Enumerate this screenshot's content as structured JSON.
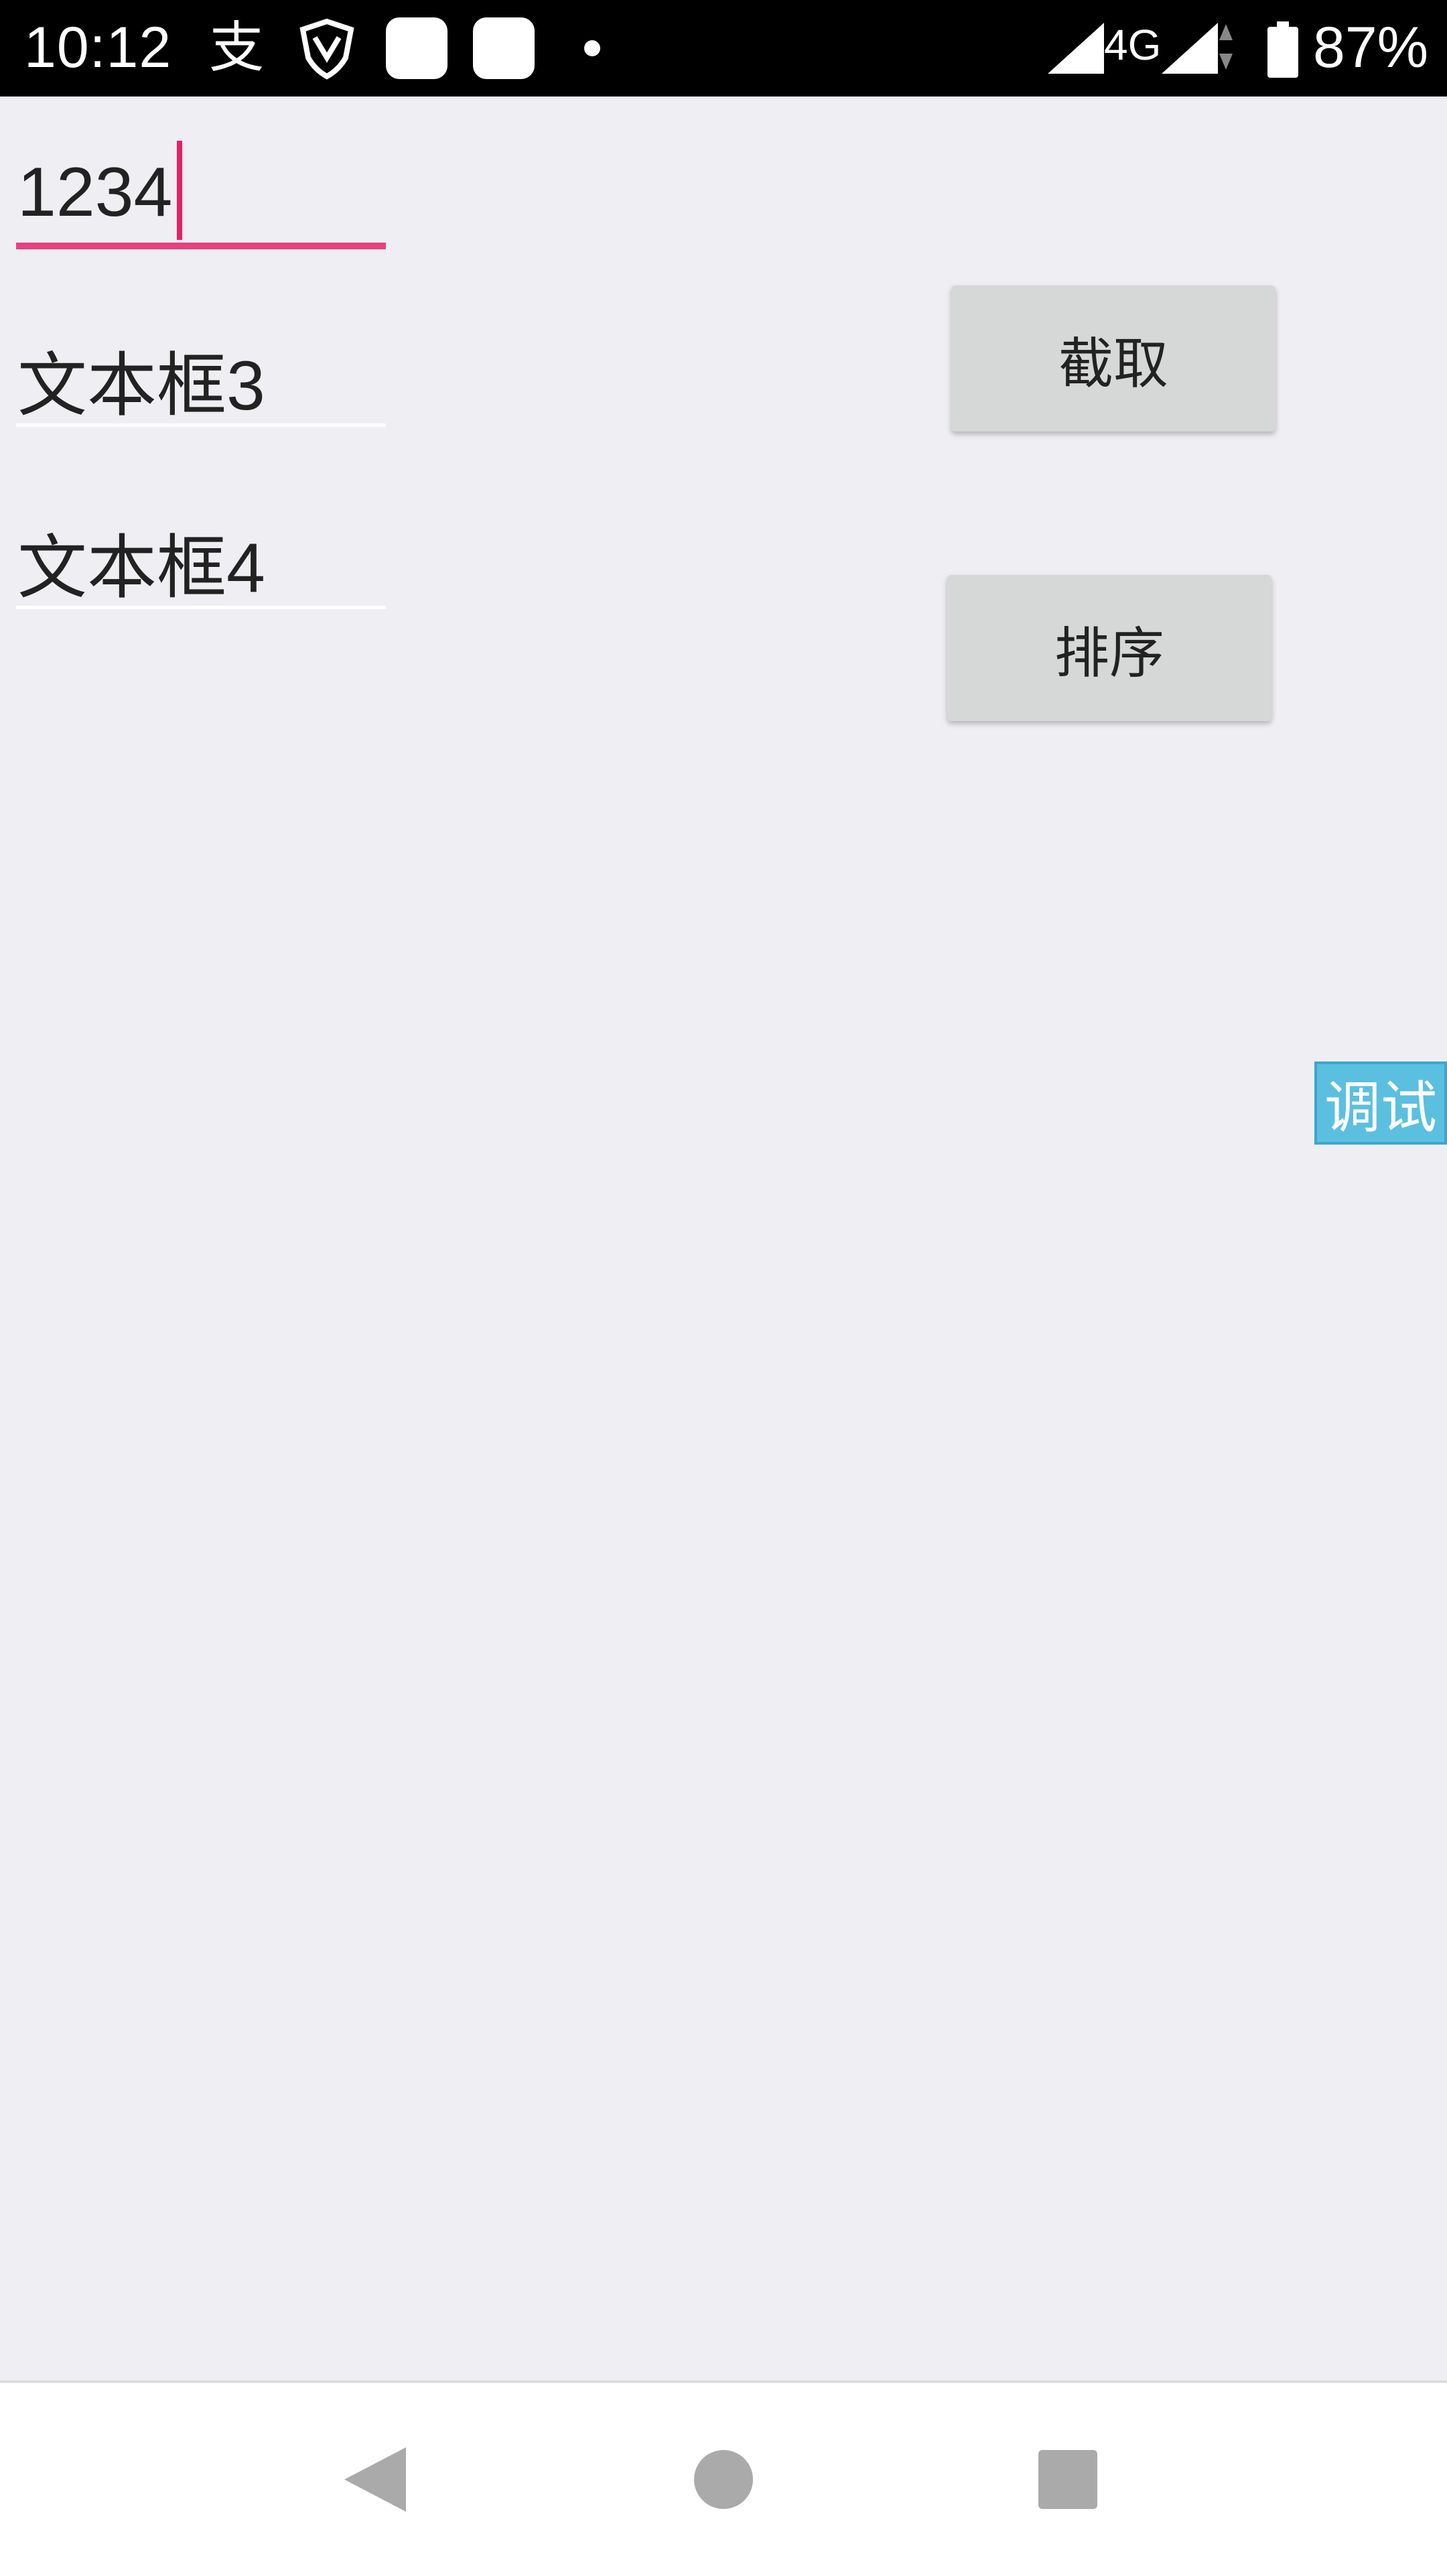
{
  "status_bar": {
    "time": "10:12",
    "alipay_glyph": "支",
    "network": "4G",
    "battery": "87%",
    "icons": [
      "alipay-icon",
      "shield-icon",
      "app-icon",
      "app-icon",
      "notification-dot-icon",
      "signal-icon",
      "signal-icon",
      "data-arrows-icon",
      "battery-icon"
    ]
  },
  "fields": [
    {
      "value": "1234",
      "focused": true
    },
    {
      "value": "文本框3",
      "focused": false
    },
    {
      "value": "文本框4",
      "focused": false
    }
  ],
  "buttons": {
    "cut": "截取",
    "sort": "排序"
  },
  "debug_label": "调试",
  "nav_bar": {
    "icons": [
      "back-icon",
      "home-icon",
      "recent-apps-icon"
    ]
  },
  "colors": {
    "accent": "#e8407a",
    "background": "#efeef3",
    "button": "#d6d7d7",
    "debug": "#5bbfe0"
  }
}
